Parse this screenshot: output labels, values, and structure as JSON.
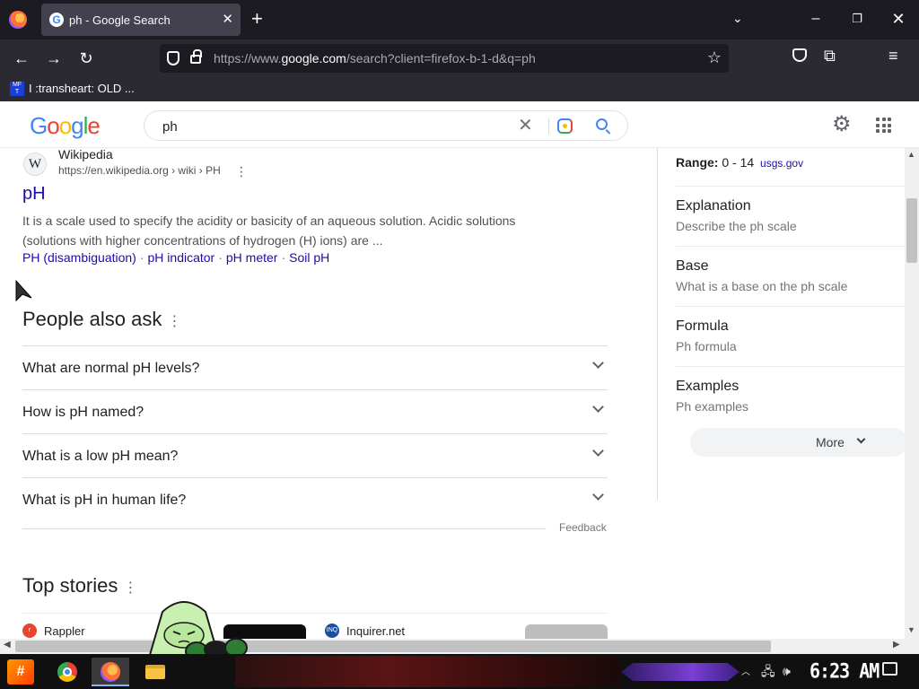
{
  "browser": {
    "tab_title": "ph - Google Search",
    "tab_favicon": "G",
    "url_domain_prefix": "https://www.",
    "url_domain": "google.com",
    "url_path": "/search?client=firefox-b-1-d&q=ph",
    "bookmark_label": "I :transheart: OLD ...",
    "bookmark_icon_text": "MF T"
  },
  "google": {
    "logo_letters": [
      "G",
      "o",
      "o",
      "g",
      "l",
      "e"
    ],
    "logo_colors": [
      "#4285f4",
      "#ea4335",
      "#fbbc05",
      "#4285f4",
      "#34a853",
      "#ea4335"
    ],
    "query": "ph"
  },
  "result": {
    "site_name": "Wikipedia",
    "favicon_letter": "W",
    "site_url": "https://en.wikipedia.org › wiki › PH",
    "title": "pH",
    "snippet": "It is a scale used to specify the acidity or basicity of an aqueous solution. Acidic solutions (solutions with higher concentrations of hydrogen (H) ions) are ...",
    "sitelinks": [
      "PH (disambiguation)",
      "pH indicator",
      "pH meter",
      "Soil pH"
    ],
    "separator": "·"
  },
  "people_also_ask": {
    "heading": "People also ask",
    "questions": [
      "What are normal pH levels?",
      "How is pH named?",
      "What is a low pH mean?",
      "What is pH in human life?"
    ],
    "feedback": "Feedback"
  },
  "top_stories": {
    "heading": "Top stories",
    "sources": [
      {
        "name": "Rappler",
        "icon_text": "r",
        "icon_color": "#e8452c"
      },
      {
        "name": "Inquirer.net",
        "icon_text": "INQ",
        "icon_color": "#1a4fa0"
      }
    ]
  },
  "knowledge_panel": {
    "range_label": "Range:",
    "range_value": "0 - 14",
    "range_source": "usgs.gov",
    "items": [
      {
        "title": "Explanation",
        "desc": "Describe the ph scale"
      },
      {
        "title": "Base",
        "desc": "What is a base on the ph scale"
      },
      {
        "title": "Formula",
        "desc": "Ph formula"
      },
      {
        "title": "Examples",
        "desc": "Ph examples"
      }
    ],
    "more_label": "More"
  },
  "taskbar": {
    "clock": "6:23 AM",
    "start_label": "#"
  }
}
